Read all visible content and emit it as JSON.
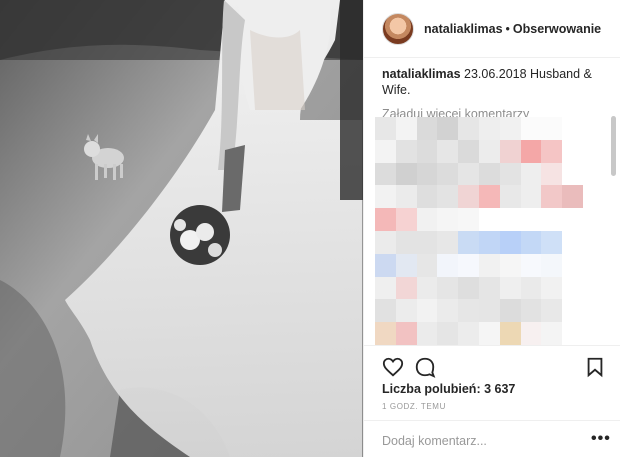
{
  "post": {
    "username": "nataliaklimas",
    "separator": "•",
    "follow_status": "Obserwowanie",
    "caption_text": "23.06.2018 Husband & Wife.",
    "load_more": "Załaduj więcej komentarzy",
    "likes": "Liczba polubień: 3 637",
    "time": "1 GODZ. TEMU",
    "add_comment_placeholder": "Dodaj komentarz...",
    "more_options": "•••"
  },
  "icons": [
    "heart-icon",
    "comment-icon",
    "bookmark-icon",
    "more-options-icon"
  ],
  "colors": {
    "text": "#262626",
    "muted": "#8e8e8e",
    "border": "#efefef"
  },
  "pixelated_comments": [
    [
      "#e7e7e7",
      "#f3f3f3",
      "#dadada",
      "#d2d2d2",
      "#e6e6e6",
      "#eeeeee",
      "#f1f1f1",
      "#fbfbfb",
      "#fbfbfb",
      "#ffffff"
    ],
    [
      "#f3f3f3",
      "#e2e2e2",
      "#dcdcdc",
      "#e6e6e6",
      "#dadada",
      "#ececec",
      "#f0d2d2",
      "#f4a7a7",
      "#f5c5c5",
      "#ffffff"
    ],
    [
      "#dcdcdc",
      "#d0d0d0",
      "#d6d6d6",
      "#dcdcdc",
      "#e5e5e5",
      "#dcdcdc",
      "#e3e3e3",
      "#eeeeee",
      "#f6e3e3",
      "#ffffff"
    ],
    [
      "#f2f2f2",
      "#ebebeb",
      "#dedede",
      "#e3e3e3",
      "#f0d4d4",
      "#f5b8b8",
      "#e8e8e8",
      "#eeeeee",
      "#f2c8c8",
      "#eabcbc"
    ],
    [
      "#f4b8b8",
      "#f6d2d2",
      "#f1f1f1",
      "#f5f5f5",
      "#f7f7f7",
      "#ffffff",
      "#ffffff",
      "#ffffff",
      "#ffffff",
      "#ffffff"
    ],
    [
      "#ebebeb",
      "#e3e3e3",
      "#e3e3e3",
      "#e7e7e7",
      "#c9dbf4",
      "#c1d6f6",
      "#b8d0f8",
      "#c3d8f6",
      "#cfe0f7",
      "#ffffff"
    ],
    [
      "#ccd9f1",
      "#e2e8f2",
      "#e6e6e6",
      "#f2f5fb",
      "#f6f8fd",
      "#f1f1f1",
      "#f6f6f6",
      "#f7f9fd",
      "#f4f7fb",
      "#ffffff"
    ],
    [
      "#efefef",
      "#f2d6d6",
      "#ebebeb",
      "#e5e5e5",
      "#dedede",
      "#e5e5e5",
      "#efefef",
      "#eaeaea",
      "#f1f1f1",
      "#ffffff"
    ],
    [
      "#e1e1e1",
      "#ececec",
      "#f2f2f2",
      "#ebebeb",
      "#e6e6e6",
      "#e5e5e5",
      "#dcdcdc",
      "#e2e2e2",
      "#e8e8e8",
      "#ffffff"
    ],
    [
      "#f0d8c2",
      "#f2c2c2",
      "#ebebeb",
      "#e5e5e5",
      "#ececec",
      "#f5f5f5",
      "#edd8b4",
      "#f7f0f0",
      "#f4f4f4",
      "#ffffff"
    ]
  ]
}
